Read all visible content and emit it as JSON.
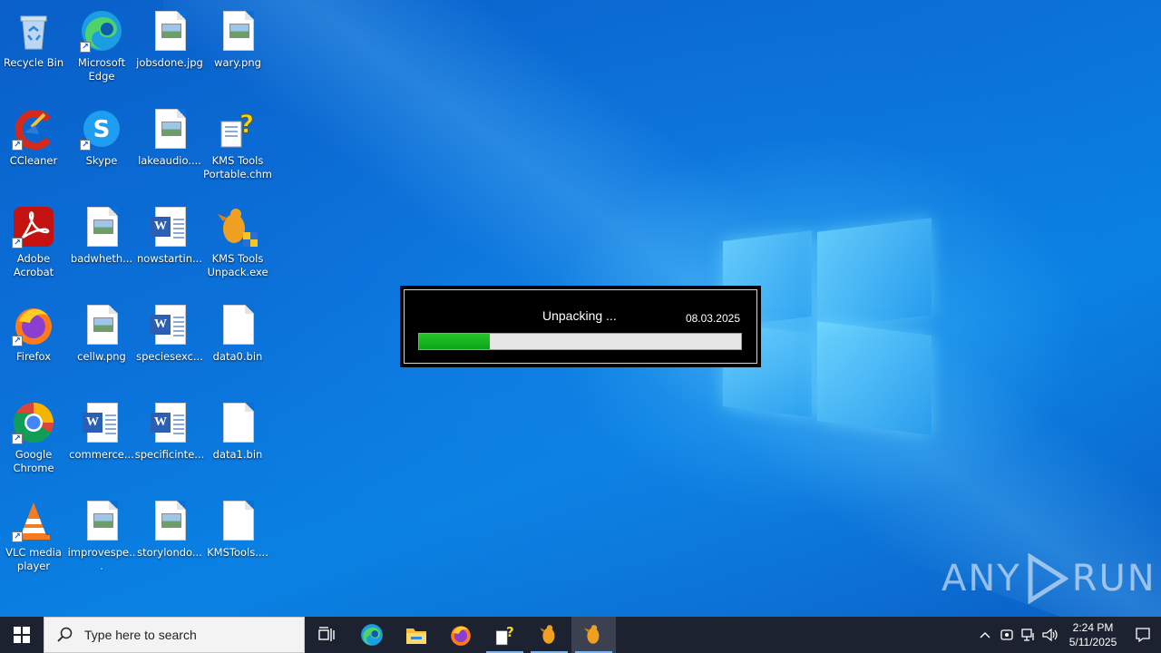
{
  "desktop": {
    "icons": [
      {
        "label": "Recycle Bin"
      },
      {
        "label": "Microsoft Edge"
      },
      {
        "label": "jobsdone.jpg"
      },
      {
        "label": "wary.png"
      },
      {
        "label": "CCleaner"
      },
      {
        "label": "Skype"
      },
      {
        "label": "lakeaudio...."
      },
      {
        "label": "KMS Tools Portable.chm"
      },
      {
        "label": "Adobe Acrobat"
      },
      {
        "label": "badwheth..."
      },
      {
        "label": "nowstartin..."
      },
      {
        "label": "KMS Tools Unpack.exe"
      },
      {
        "label": "Firefox"
      },
      {
        "label": "cellw.png"
      },
      {
        "label": "speciesexc..."
      },
      {
        "label": "data0.bin"
      },
      {
        "label": "Google Chrome"
      },
      {
        "label": "commerce..."
      },
      {
        "label": "specificinte..."
      },
      {
        "label": "data1.bin"
      },
      {
        "label": "VLC media player"
      },
      {
        "label": "improvespe..."
      },
      {
        "label": "storylondo..."
      },
      {
        "label": "KMSTools...."
      }
    ]
  },
  "dialog": {
    "status": "Unpacking ...",
    "date": "08.03.2025",
    "progress": 0.22
  },
  "watermark": {
    "left": "ANY",
    "right": "RUN"
  },
  "taskbar": {
    "search_placeholder": "Type here to search",
    "clock_time": "2:24 PM",
    "clock_date": "5/11/2025"
  },
  "colors": {
    "progress": "#14b01f",
    "taskbar": "#1c2230",
    "wallpaper": "#0a6fd8"
  }
}
